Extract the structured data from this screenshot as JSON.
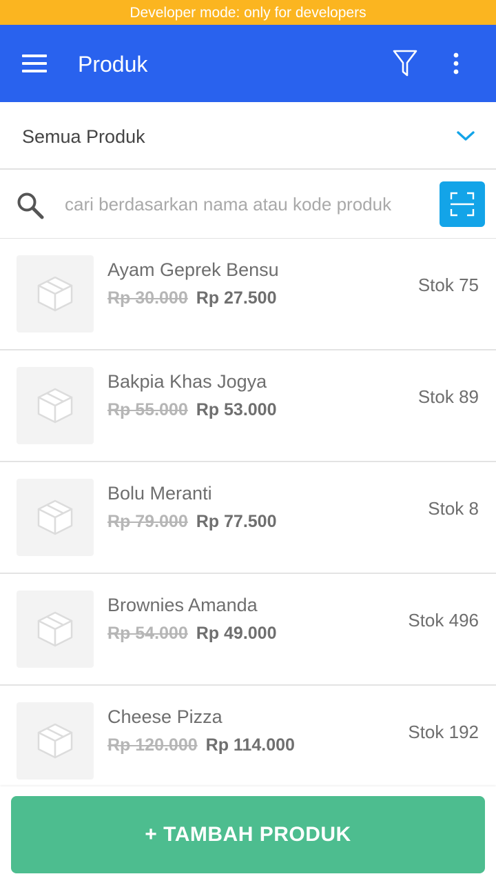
{
  "dev_banner": "Developer mode: only for developers",
  "colors": {
    "app_bar": "#2962ee",
    "dev_banner": "#fbb520",
    "scan_button": "#13a4e8",
    "chevron": "#13a4e8",
    "add_button": "#4dbd8f"
  },
  "app_bar": {
    "title": "Produk",
    "menu_icon": "hamburger-menu-icon",
    "filter_icon": "filter-funnel-icon",
    "more_icon": "more-vertical-icon"
  },
  "category": {
    "selected": "Semua Produk",
    "icon": "chevron-down-icon"
  },
  "search": {
    "placeholder": "cari berdasarkan nama atau kode produk",
    "value": "",
    "icon": "search-icon",
    "scan_icon": "barcode-scan-icon"
  },
  "products": [
    {
      "name": "Ayam Geprek Bensu",
      "old_price": "Rp 30.000",
      "price": "Rp 27.500",
      "stock": "Stok 75"
    },
    {
      "name": "Bakpia Khas Jogya",
      "old_price": "Rp 55.000",
      "price": "Rp 53.000",
      "stock": "Stok 89"
    },
    {
      "name": "Bolu Meranti",
      "old_price": "Rp 79.000",
      "price": "Rp 77.500",
      "stock": "Stok 8"
    },
    {
      "name": "Brownies Amanda",
      "old_price": "Rp 54.000",
      "price": "Rp 49.000",
      "stock": "Stok 496"
    },
    {
      "name": "Cheese Pizza",
      "old_price": "Rp 120.000",
      "price": "Rp 114.000",
      "stock": "Stok 192"
    }
  ],
  "add_button_label": "+ TAMBAH PRODUK"
}
